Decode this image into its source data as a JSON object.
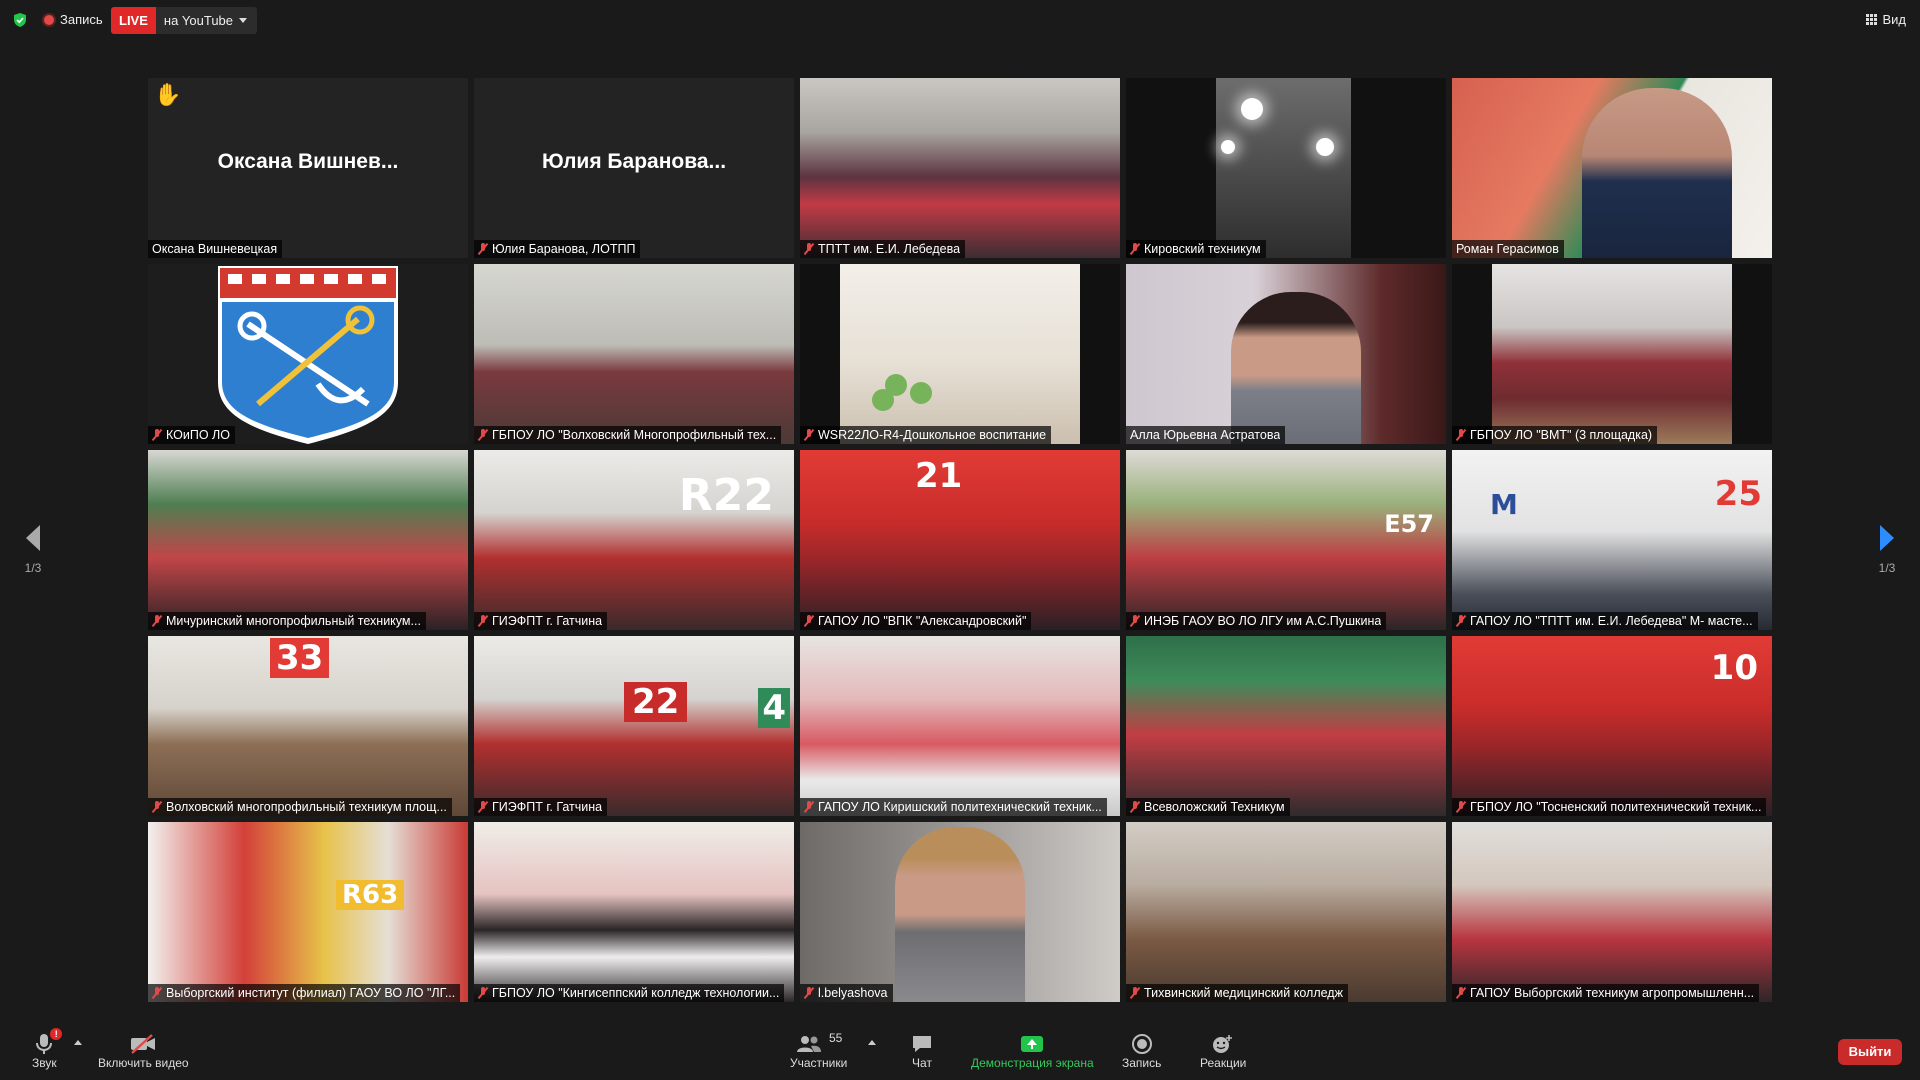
{
  "topbar": {
    "record_label": "Запись",
    "live_badge": "LIVE",
    "live_target": "на YouTube",
    "view_label": "Вид"
  },
  "colors": {
    "background": "#1a1a1a",
    "live_red": "#e02828",
    "active_speaker_outline": "#f0e968",
    "share_green": "#23c44a",
    "exit_red": "#c92a2a",
    "next_page_blue": "#2d8cff"
  },
  "tiles": [
    {
      "label": "Оксана Вишневецкая",
      "display_name": "Оксана Вишнев...",
      "muted": false,
      "hand_raised": true
    },
    {
      "label": "Юлия Баранова, ЛОТПП",
      "display_name": "Юлия Баранова...",
      "muted": true
    },
    {
      "label": "ТПТТ им. Е.И. Лебедева",
      "muted": true
    },
    {
      "label": "Кировский техникум",
      "muted": true
    },
    {
      "label": "Роман Герасимов",
      "muted": false
    },
    {
      "label": "КОиПО ЛО",
      "muted": true
    },
    {
      "label": "ГБПОУ ЛО \"Волховский Многопрофильный тех...",
      "muted": true
    },
    {
      "label": "WSR22ЛО-R4-Дошкольное воспитание",
      "muted": true
    },
    {
      "label": "Алла Юрьевна Астратова",
      "muted": false,
      "active_speaker": true
    },
    {
      "label": "ГБПОУ ЛО \"ВМТ\" (3 площадка)",
      "muted": true
    },
    {
      "label": "Мичуринский многопрофильный техникум...",
      "muted": true
    },
    {
      "label": "ГИЭФПТ г. Гатчина",
      "muted": true
    },
    {
      "label": "ГАПОУ ЛО \"ВПК \"Александровский\"",
      "muted": true
    },
    {
      "label": "ИНЭБ ГАОУ ВО ЛО ЛГУ им А.С.Пушкина",
      "muted": true
    },
    {
      "label": "ГАПОУ ЛО \"ТПТТ им. Е.И. Лебедева\" М- масте...",
      "muted": true
    },
    {
      "label": "Волховский многопрофильный техникум площ...",
      "muted": true
    },
    {
      "label": "ГИЭФПТ г. Гатчина",
      "muted": true
    },
    {
      "label": "ГАПОУ ЛО Киришский политехнический техник...",
      "muted": true
    },
    {
      "label": "Всеволожский Техникум",
      "muted": true
    },
    {
      "label": "ГБПОУ ЛО \"Тосненский политехнический техник...",
      "muted": true
    },
    {
      "label": "Выборгский институт (филиал) ГАОУ ВО ЛО \"ЛГ...",
      "muted": true
    },
    {
      "label": "ГБПОУ ЛО \"Кингисеппский колледж технологии...",
      "muted": true
    },
    {
      "label": "l.belyashova",
      "muted": true
    },
    {
      "label": "Тихвинский медицинский колледж",
      "muted": true
    },
    {
      "label": "ГАПОУ Выборгский техникум агропромышленн...",
      "muted": true
    }
  ],
  "scene_text": {
    "hall_r22": "R22",
    "num_21": "21",
    "num_e57": "E57",
    "num_25": "25",
    "num_m": "M",
    "num_33": "33",
    "num_22": "22",
    "num_10": "10",
    "num_r63": "R63",
    "num_4": "4"
  },
  "pagination": {
    "left_indicator": "1/3",
    "right_indicator": "1/3"
  },
  "toolbar": {
    "audio_label": "Звук",
    "audio_badge": "!",
    "video_label": "Включить видео",
    "participants_label": "Участники",
    "participants_count": "55",
    "chat_label": "Чат",
    "share_label": "Демонстрация экрана",
    "record_label": "Запись",
    "reactions_label": "Реакции",
    "exit_label": "Выйти"
  }
}
